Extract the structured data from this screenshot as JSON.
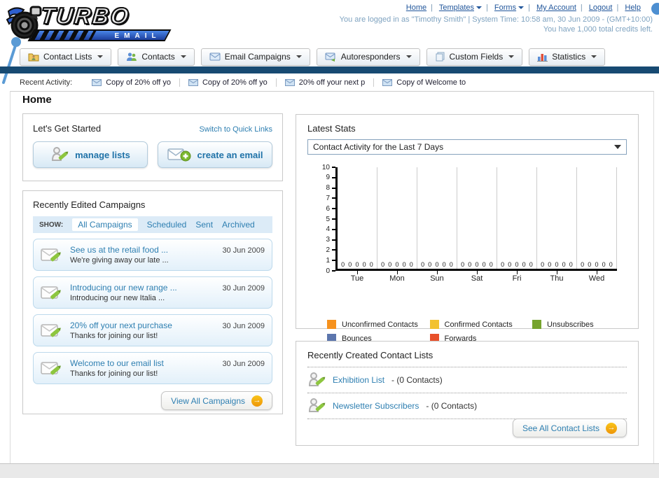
{
  "logo": {
    "line1": "TURBO",
    "line2": "EMAIL"
  },
  "header": {
    "links": {
      "home": "Home",
      "templates": "Templates",
      "forms": "Forms",
      "my_account": "My Account",
      "logout": "Logout",
      "help": "Help"
    },
    "login_status": "You are logged in as \"Timothy Smith\" | System Time: 10:58 am, 30 Jun 2009 - (GMT+10:00)",
    "credits": "You have 1,000 total credits left."
  },
  "nav": {
    "tabs": [
      {
        "label": "Contact Lists"
      },
      {
        "label": "Contacts"
      },
      {
        "label": "Email Campaigns"
      },
      {
        "label": "Autoresponders"
      },
      {
        "label": "Custom Fields"
      },
      {
        "label": "Statistics"
      }
    ]
  },
  "recent_activity": {
    "label": "Recent Activity:",
    "items": [
      "Copy of 20% off yo",
      "Copy of 20% off yo",
      "20% off your next p",
      "Copy of Welcome to"
    ]
  },
  "page_title": "Home",
  "get_started": {
    "title": "Let's Get Started",
    "switch_link": "Switch to Quick Links",
    "buttons": [
      {
        "label": "manage lists"
      },
      {
        "label": "create an email"
      }
    ]
  },
  "campaigns": {
    "title": "Recently Edited Campaigns",
    "show_label": "SHOW:",
    "filters": [
      "All Campaigns",
      "Scheduled",
      "Sent",
      "Archived"
    ],
    "active_filter": "All Campaigns",
    "items": [
      {
        "title": "See us at the retail food ...",
        "subtitle": "We're giving away our late ...",
        "date": "30 Jun 2009"
      },
      {
        "title": "Introducing our new range ...",
        "subtitle": "Introducing our new Italia ...",
        "date": "30 Jun 2009"
      },
      {
        "title": "20% off your next purchase",
        "subtitle": "Thanks for joining our list!",
        "date": "30 Jun 2009"
      },
      {
        "title": "Welcome to our email list",
        "subtitle": "Thanks for joining our list!",
        "date": "30 Jun 2009"
      }
    ],
    "view_all_label": "View All Campaigns"
  },
  "latest_stats": {
    "title": "Latest Stats",
    "selected_option": "Contact Activity for the Last 7 Days"
  },
  "chart_data": {
    "type": "bar",
    "title": "Contact Activity for the Last 7 Days",
    "categories": [
      "Tue",
      "Mon",
      "Sun",
      "Sat",
      "Fri",
      "Thu",
      "Wed"
    ],
    "series": [
      {
        "name": "Unconfirmed Contacts",
        "color": "#f6921e",
        "values": [
          0,
          0,
          0,
          0,
          0,
          0,
          0
        ]
      },
      {
        "name": "Confirmed Contacts",
        "color": "#f2c230",
        "values": [
          0,
          0,
          0,
          0,
          0,
          0,
          0
        ]
      },
      {
        "name": "Unsubscribes",
        "color": "#76a32e",
        "values": [
          0,
          0,
          0,
          0,
          0,
          0,
          0
        ]
      },
      {
        "name": "Bounces",
        "color": "#5c76ad",
        "values": [
          0,
          0,
          0,
          0,
          0,
          0,
          0
        ]
      },
      {
        "name": "Forwards",
        "color": "#e8502a",
        "values": [
          0,
          0,
          0,
          0,
          0,
          0,
          0
        ]
      }
    ],
    "xlabel": "",
    "ylabel": "",
    "ylim": [
      0,
      10
    ],
    "ytick_step": 1,
    "grid": "vertical",
    "legend_position": "bottom",
    "data_labels": "zeros shown above baseline for every series in every category"
  },
  "contact_lists": {
    "title": "Recently Created Contact Lists",
    "items": [
      {
        "name": "Exhibition List",
        "detail": "- (0 Contacts)"
      },
      {
        "name": "Newsletter Subscribers",
        "detail": "- (0 Contacts)"
      }
    ],
    "see_all_label": "See All Contact Lists"
  }
}
